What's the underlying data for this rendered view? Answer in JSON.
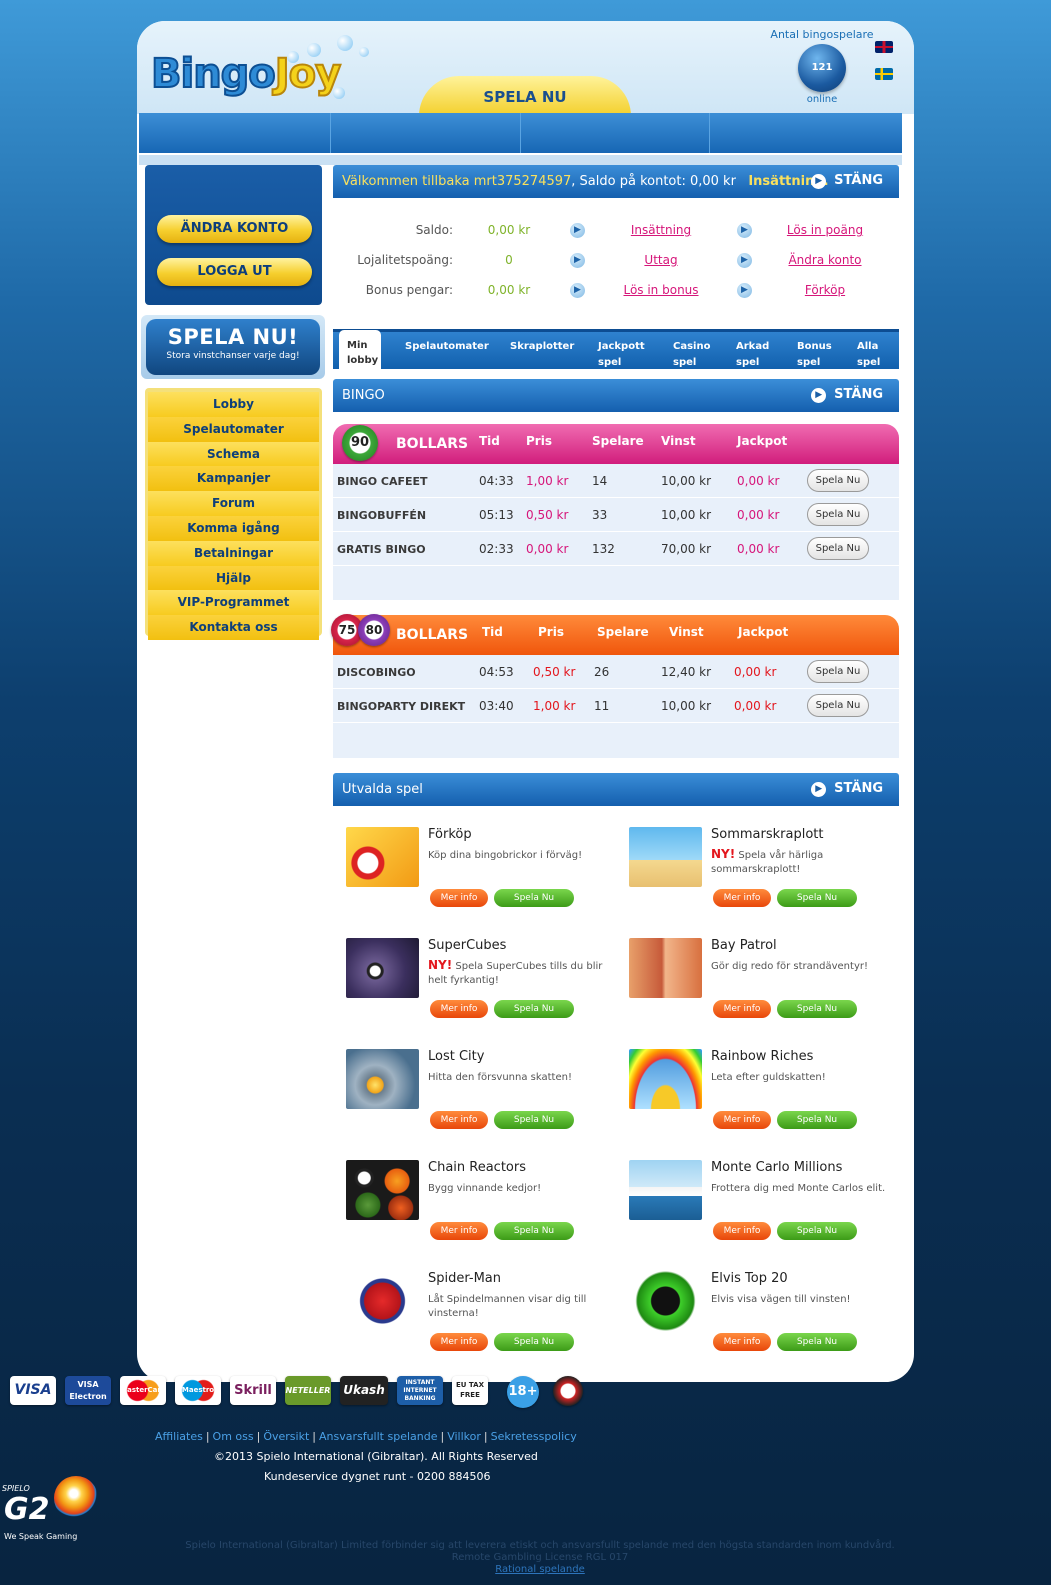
{
  "header": {
    "logo_part1": "Bingo",
    "logo_part2": "Joy",
    "play_now_tab": "SPELA NU",
    "players_label": "Antal bingospelare",
    "players_count": "121",
    "players_online": "online",
    "flags": [
      "uk-flag",
      "swedish-flag"
    ]
  },
  "account_box": {
    "change_account": "ÄNDRA KONTO",
    "logout": "LOGGA UT"
  },
  "promo": {
    "title": "SPELA NU!",
    "subtitle": "Stora vinstchanser varje dag!"
  },
  "sidebar_menu": [
    "Lobby",
    "Spelautomater",
    "Schema",
    "Kampanjer",
    "Forum",
    "Komma igång",
    "Betalningar",
    "Hjälp",
    "VIP-Programmet",
    "Kontakta oss"
  ],
  "welcome": {
    "prefix": "Välkommen tillbaka ",
    "username": "mrt375274597",
    "balance_text": ", Saldo på kontot: 0,00 kr",
    "deposit_link": "Insättning.",
    "close": "STÄNG"
  },
  "account_rows": [
    {
      "label": "Saldo:",
      "value": "0,00 kr",
      "link1": "Insättning",
      "link2": "Lös in poäng"
    },
    {
      "label": "Lojalitetspoäng:",
      "value": "0",
      "link1": "Uttag",
      "link2": "Ändra konto"
    },
    {
      "label": "Bonus pengar:",
      "value": "0,00 kr",
      "link1": "Lös in bonus",
      "link2": "Förköp"
    }
  ],
  "tabs": {
    "active": [
      "Min",
      "lobby"
    ],
    "items": [
      [
        "Spelautomater",
        ""
      ],
      [
        "Skraplotter",
        ""
      ],
      [
        "Jackpott",
        "spel"
      ],
      [
        "Casino",
        "spel"
      ],
      [
        "Arkad",
        "spel"
      ],
      [
        "Bonus",
        "spel"
      ],
      [
        "Alla",
        "spel"
      ]
    ]
  },
  "bingo_section": {
    "title": "BINGO",
    "close": "STÄNG",
    "columns": [
      "Tid",
      "Pris",
      "Spelare",
      "Vinst",
      "Jackpot"
    ],
    "play_label": "Spela Nu",
    "ball90": {
      "ball_labels": [
        "90"
      ],
      "bollars": "BOLLARS",
      "rows": [
        {
          "name": "BINGO CAFEET",
          "tid": "04:33",
          "pris": "1,00 kr",
          "spelare": "14",
          "vinst": "10,00 kr",
          "jackpot": "0,00 kr"
        },
        {
          "name": "BINGOBUFFÉN",
          "tid": "05:13",
          "pris": "0,50 kr",
          "spelare": "33",
          "vinst": "10,00 kr",
          "jackpot": "0,00 kr"
        },
        {
          "name": "GRATIS BINGO",
          "tid": "02:33",
          "pris": "0,00 kr",
          "spelare": "132",
          "vinst": "70,00 kr",
          "jackpot": "0,00 kr"
        }
      ]
    },
    "ball7580": {
      "ball_labels": [
        "75",
        "80"
      ],
      "bollars": "BOLLARS",
      "rows": [
        {
          "name": "DISCOBINGO",
          "tid": "04:53",
          "pris": "0,50 kr",
          "spelare": "26",
          "vinst": "12,40 kr",
          "jackpot": "0,00 kr"
        },
        {
          "name": "BINGOPARTY DIREKT",
          "tid": "03:40",
          "pris": "1,00 kr",
          "spelare": "11",
          "vinst": "10,00 kr",
          "jackpot": "0,00 kr"
        }
      ]
    }
  },
  "featured": {
    "title": "Utvalda spel",
    "close": "STÄNG",
    "more_info": "Mer info",
    "play": "Spela Nu",
    "games": [
      {
        "title": "Förköp",
        "ny": "",
        "desc": "Köp dina bingobrickor i förväg!"
      },
      {
        "title": "Sommarskraplott",
        "ny": "NY!",
        "desc": " Spela vår härliga sommarskraplott!"
      },
      {
        "title": "SuperCubes",
        "ny": "NY!",
        "desc": " Spela SuperCubes tills du blir helt fyrkantig!"
      },
      {
        "title": "Bay Patrol",
        "ny": "",
        "desc": "Gör dig redo för strandäventyr!"
      },
      {
        "title": "Lost City",
        "ny": "",
        "desc": "Hitta den försvunna skatten!"
      },
      {
        "title": "Rainbow Riches",
        "ny": "",
        "desc": "Leta efter guldskatten!"
      },
      {
        "title": "Chain Reactors",
        "ny": "",
        "desc": "Bygg vinnande kedjor!"
      },
      {
        "title": "Monte Carlo Millions",
        "ny": "",
        "desc": "Frottera dig med Monte Carlos elit."
      },
      {
        "title": "Spider-Man",
        "ny": "",
        "desc": "Låt Spindelmannen visar dig till vinsterna!"
      },
      {
        "title": "Elvis Top 20",
        "ny": "",
        "desc": "Elvis visa vägen till vinsten!"
      }
    ]
  },
  "payments": [
    "VISA",
    "VISA Electron",
    "MasterCard",
    "Maestro",
    "Skrill",
    "NETELLER",
    "Ukash",
    "INSTANT INTERNET BANKING",
    "EU TAX FREE",
    "18+"
  ],
  "footer": {
    "links": [
      "Affiliates",
      "Om oss",
      "Översikt",
      "Ansvarsfullt spelande",
      "Villkor",
      "Sekretesspolicy"
    ],
    "copyright": "©2013 Spielo International (Gibraltar). All Rights Reserved",
    "service": "Kundeservice dygnet runt - 0200 884506",
    "g2_top": "SPIELO",
    "g2_mid": "G2",
    "g2_tag": "We Speak Gaming",
    "disclaimer": "Spielo International (Gibraltar) Limited förbinder sig att leverera etiskt och ansvarsfullt spelande med den högsta standarden inom kundvård.",
    "license": "Remote Gambling License RGL 017",
    "responsible": "Rational spelande"
  }
}
